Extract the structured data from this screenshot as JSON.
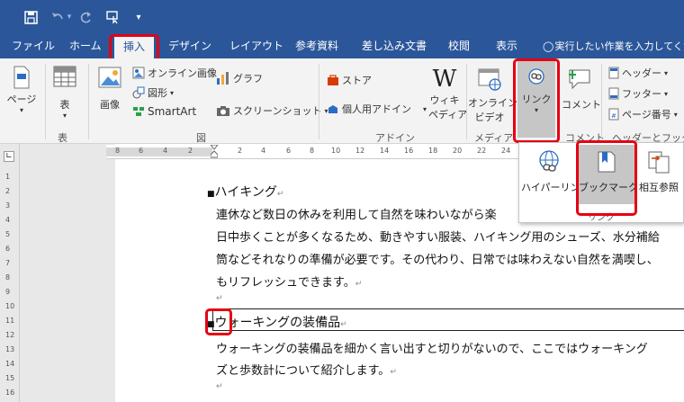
{
  "quick_access": {
    "save": "save-icon",
    "undo": "undo-icon",
    "redo": "redo-icon",
    "touch": "touch-mode-icon",
    "more": "▾"
  },
  "tabs": [
    "ファイル",
    "ホーム",
    "挿入",
    "デザイン",
    "レイアウト",
    "参考資料",
    "差し込み文書",
    "校閲",
    "表示"
  ],
  "tell_me": "実行したい作業を入力してくだ",
  "ribbon": {
    "page": "ページ",
    "table": "表",
    "image": "画像",
    "online_image": "オンライン画像",
    "shapes": "図形",
    "smartart": "SmartArt",
    "graph": "グラフ",
    "screenshot": "スクリーンショット",
    "store": "ストア",
    "personal_addins": "個人用アドイン",
    "wiki_1": "ウィキ",
    "wiki_2": "ペディア",
    "online_video_1": "オンライン",
    "online_video_2": "ビデオ",
    "link": "リンク",
    "comment": "コメント",
    "header": "ヘッダー",
    "footer": "フッター",
    "page_number": "ページ番号",
    "groups": {
      "table": "表",
      "figure": "図",
      "addin": "アドイン",
      "media": "メディア",
      "comment": "コメント",
      "headerfooter": "ヘッダーとフッター"
    }
  },
  "dropdown": {
    "hyperlink": "ハイパーリンク",
    "bookmark": "ブックマーク",
    "cross_ref": "相互参照",
    "group": "リンク"
  },
  "ruler_h": [
    "8",
    "6",
    "4",
    "2",
    "",
    "2",
    "4",
    "6",
    "8",
    "10",
    "12",
    "14",
    "16",
    "18",
    "20",
    "22",
    "24"
  ],
  "ruler_v": [
    "1",
    "2",
    "3",
    "4",
    "5",
    "6",
    "7",
    "8",
    "9",
    "10",
    "11",
    "12",
    "13",
    "14",
    "15",
    "16",
    "17"
  ],
  "document": {
    "h1": "ハイキング",
    "p1": [
      "連休など数日の休みを利用して自然を味わいながら楽",
      "日中歩くことが多くなるため、動きやすい服装、ハイキング用のシューズ、水分補給",
      "筒などそれなりの準備が必要です。その代わり、日常では味わえない自然を満喫し、",
      "もリフレッシュできます。"
    ],
    "h2": "ウォーキングの装備品",
    "p2": [
      "ウォーキングの装備品を細かく言い出すと切りがないので、ここではウォーキング",
      "ズと歩数計について紹介します。"
    ],
    "para_mark": "↵"
  },
  "colors": {
    "brand": "#2b579a",
    "highlight": "#e60012"
  }
}
